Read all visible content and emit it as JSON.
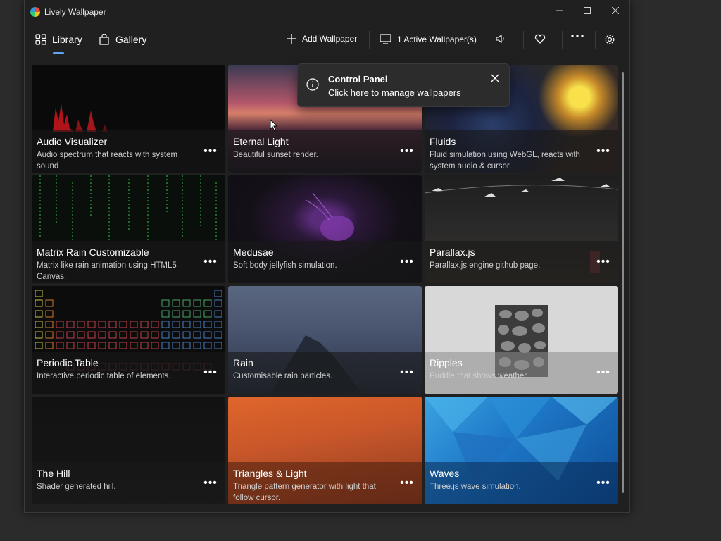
{
  "window": {
    "title": "Lively Wallpaper"
  },
  "nav": {
    "library": "Library",
    "gallery": "Gallery"
  },
  "toolbar": {
    "add_wallpaper": "Add Wallpaper",
    "active_wallpapers": "1 Active Wallpaper(s)"
  },
  "toast": {
    "title": "Control Panel",
    "subtitle": "Click here to manage wallpapers"
  },
  "wallpapers": [
    {
      "title": "Audio Visualizer",
      "description": "Audio spectrum that reacts with system sound"
    },
    {
      "title": "Eternal Light",
      "description": "Beautiful sunset render."
    },
    {
      "title": "Fluids",
      "description": "Fluid simulation using WebGL, reacts with system audio & cursor."
    },
    {
      "title": "Matrix Rain Customizable",
      "description": "Matrix like rain animation using HTML5 Canvas."
    },
    {
      "title": "Medusae",
      "description": "Soft body jellyfish simulation."
    },
    {
      "title": "Parallax.js",
      "description": "Parallax.js engine github page."
    },
    {
      "title": "Periodic Table",
      "description": "Interactive periodic table of elements."
    },
    {
      "title": "Rain",
      "description": "Customisable rain particles."
    },
    {
      "title": "Ripples",
      "description": "Puddle that shows weather."
    },
    {
      "title": "The Hill",
      "description": "Shader generated hill."
    },
    {
      "title": "Triangles & Light",
      "description": "Triangle pattern generator with light that follow cursor."
    },
    {
      "title": "Waves",
      "description": "Three.js wave simulation."
    }
  ],
  "selected_wallpaper": "Eternal Light",
  "colors": {
    "accent": "#60a5f1",
    "selection": "#5fb3e6",
    "background": "#202020"
  }
}
